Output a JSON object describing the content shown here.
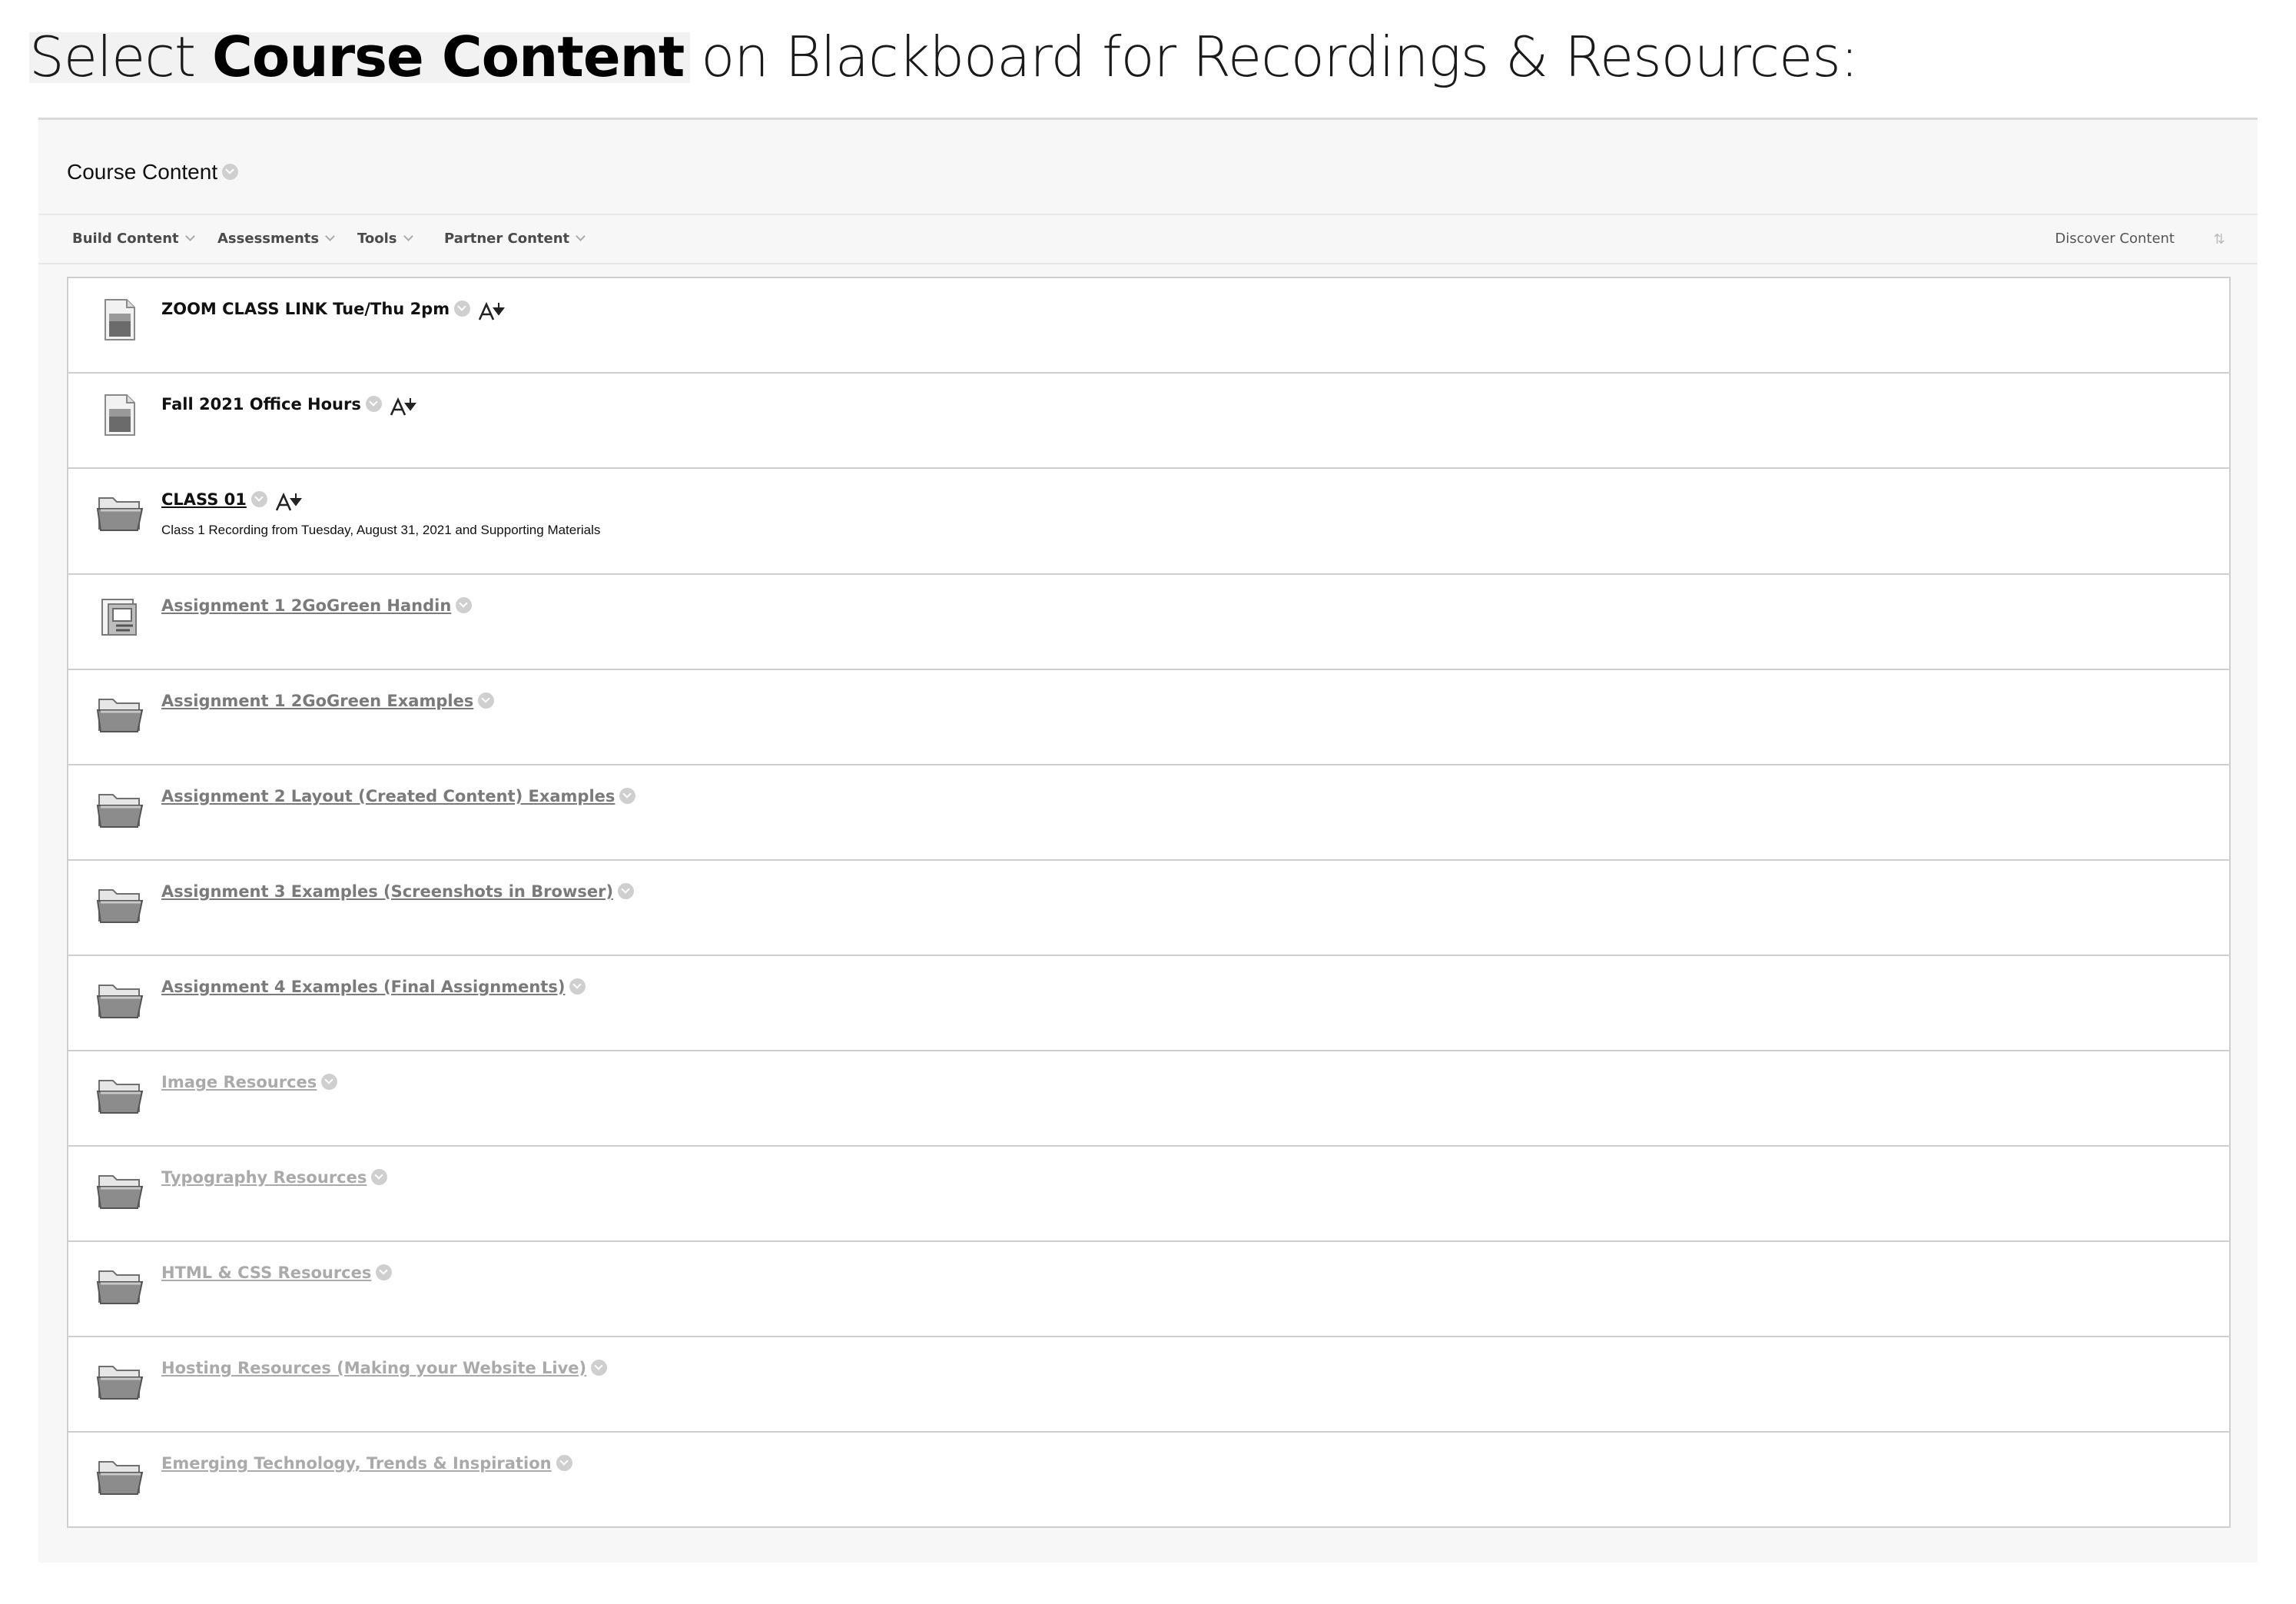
{
  "headline": {
    "prefix": "Select ",
    "emphasis": "Course Content",
    "suffix": " on Blackboard for Recordings & Resources:"
  },
  "page": {
    "title": "Course Content"
  },
  "toolbar": {
    "build_content": "Build Content",
    "assessments": "Assessments",
    "tools": "Tools",
    "partner_content": "Partner Content",
    "discover_content": "Discover Content",
    "reorder_glyph": "⇅"
  },
  "items": [
    {
      "title": "ZOOM CLASS LINK Tue/Thu 2pm",
      "icon": "document-icon",
      "style": "plain",
      "adaptive": true
    },
    {
      "title": "Fall 2021 Office Hours",
      "icon": "document-icon",
      "style": "plain",
      "adaptive": true
    },
    {
      "title": "CLASS 01",
      "icon": "folder-icon",
      "style": "link-dark",
      "adaptive": true,
      "description": "Class 1 Recording from Tuesday, August 31, 2021 and Supporting Materials"
    },
    {
      "title": "Assignment 1 2GoGreen Handin",
      "icon": "assignment-icon",
      "style": "link-gray"
    },
    {
      "title": "Assignment 1 2GoGreen Examples",
      "icon": "folder-icon",
      "style": "link-gray"
    },
    {
      "title": "Assignment 2 Layout (Created Content) Examples",
      "icon": "folder-icon",
      "style": "link-gray"
    },
    {
      "title": "Assignment 3 Examples (Screenshots in Browser)",
      "icon": "folder-icon",
      "style": "link-gray"
    },
    {
      "title": "Assignment 4 Examples (Final Assignments)",
      "icon": "folder-icon",
      "style": "link-gray"
    },
    {
      "title": "Image Resources",
      "icon": "folder-icon",
      "style": "link-light"
    },
    {
      "title": "Typography Resources",
      "icon": "folder-icon",
      "style": "link-light"
    },
    {
      "title": "HTML & CSS Resources",
      "icon": "folder-icon",
      "style": "link-light"
    },
    {
      "title": "Hosting Resources (Making your Website Live)",
      "icon": "folder-icon",
      "style": "link-light"
    },
    {
      "title": "Emerging Technology, Trends & Inspiration",
      "icon": "folder-icon",
      "style": "link-light"
    }
  ]
}
